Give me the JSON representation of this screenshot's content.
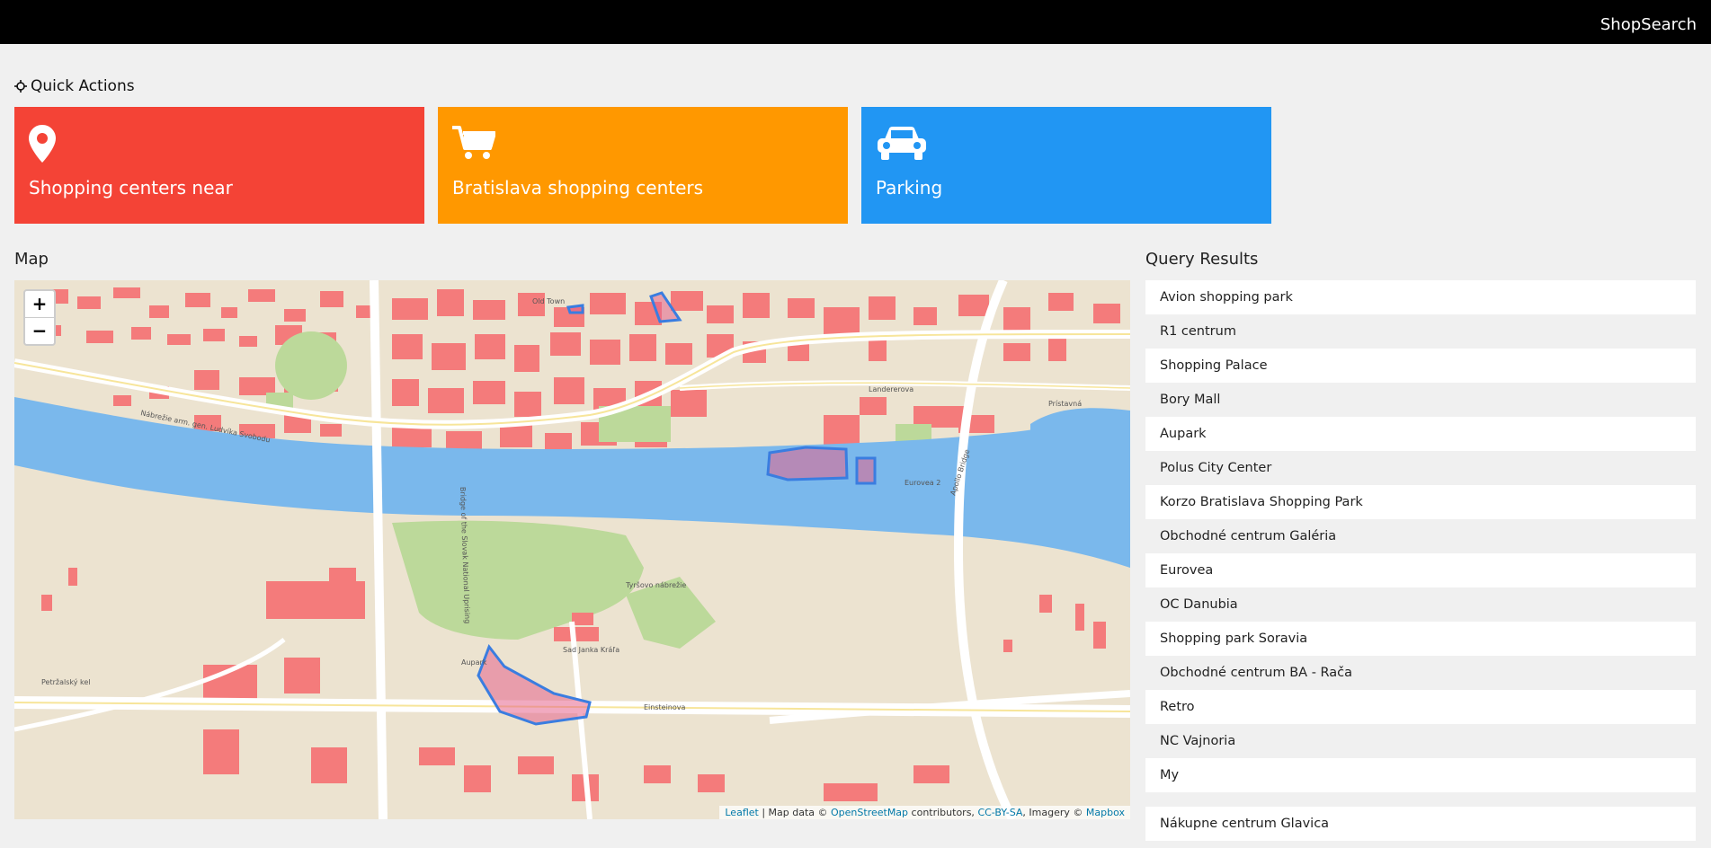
{
  "app": {
    "brand": "ShopSearch"
  },
  "quick_actions": {
    "title": "Quick Actions",
    "tiles": [
      {
        "label": "Shopping centers near",
        "icon": "map-marker-icon",
        "color": "#f44336"
      },
      {
        "label": "Bratislava shopping centers",
        "icon": "shopping-cart-icon",
        "color": "#ff9800"
      },
      {
        "label": "Parking",
        "icon": "car-icon",
        "color": "#2196f3"
      }
    ]
  },
  "map": {
    "title": "Map",
    "zoom_in": "+",
    "zoom_out": "−",
    "attribution": {
      "leaflet": "Leaflet",
      "sep1": " | Map data © ",
      "osm": "OpenStreetMap",
      "contrib": " contributors, ",
      "license": "CC-BY-SA",
      "imagery": ", Imagery © ",
      "mapbox": "Mapbox"
    },
    "labels": {
      "einsteinova": "Einsteinova",
      "nabrezie": "Nábrežie arm. gen. Ludvíka Svobodu",
      "most_snp": "Bridge of the Slovak National Uprising",
      "apollo": "Apollo Bridge",
      "landererova": "Landererova",
      "pristavna": "Prístavná",
      "eurovea": "Eurovea 2",
      "aupark": "Aupark",
      "sad_janka_krala": "Sad Janka Kráľa",
      "tyrsovo": "Tyršovo nábrežie",
      "petrzalka": "Petržalský kel",
      "old_town": "Old Town"
    }
  },
  "results": {
    "title": "Query Results",
    "items": [
      "Avion shopping park",
      "R1 centrum",
      "Shopping Palace",
      "Bory Mall",
      "Aupark",
      "Polus City Center",
      "Korzo Bratislava Shopping Park",
      "Obchodné centrum Galéria",
      "Eurovea",
      "OC Danubia",
      "Shopping park Soravia",
      "Obchodné centrum BA - Rača",
      "Retro",
      "NC Vajnoria",
      "My",
      "Nákupne centrum Glavica"
    ]
  },
  "colors": {
    "river": "#7ab8ec",
    "buildings": "#f47b7b",
    "park": "#bcd99a",
    "land": "#ece3d0",
    "highlight_stroke": "#3a7de0"
  }
}
